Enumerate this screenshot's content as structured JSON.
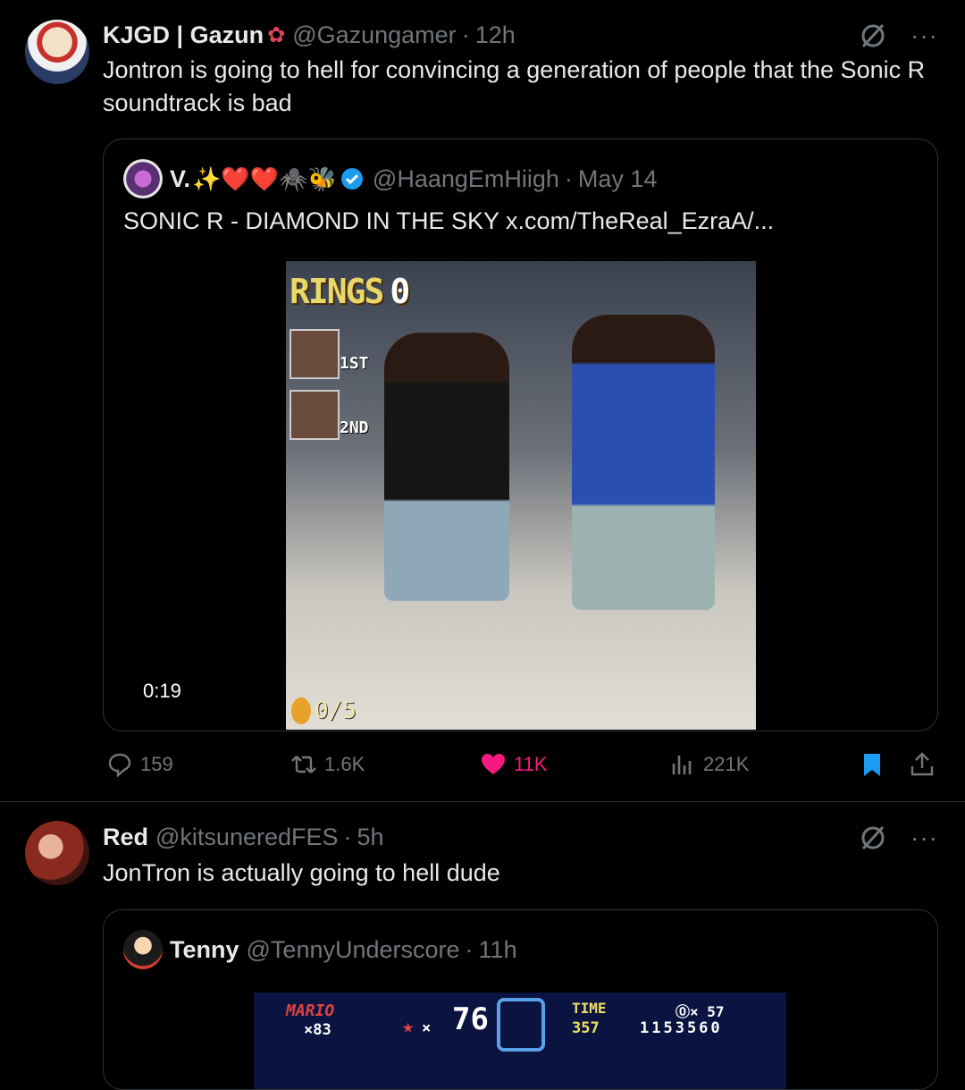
{
  "tweet1": {
    "name": "KJGD | Gazun",
    "handle": "@Gazungamer",
    "time": "12h",
    "text": "Jontron is going to hell for convincing a generation of people that the Sonic R soundtrack is bad",
    "quote": {
      "name": "V.",
      "emojis": "✨❤️❤️🕷️🐝",
      "handle": "@HaangEmHiigh",
      "time": "May 14",
      "text": "SONIC R - DIAMOND IN THE SKY  x.com/TheReal_EzraA/...",
      "video_duration": "0:19",
      "hud": {
        "rings_label": "RINGS",
        "rings_value": "0",
        "first": "1ST",
        "second": "2ND",
        "coins": "0/5"
      }
    },
    "actions": {
      "replies": "159",
      "reposts": "1.6K",
      "likes": "11K",
      "views": "221K"
    }
  },
  "tweet2": {
    "name": "Red",
    "handle": "@kitsuneredFES",
    "time": "5h",
    "text": "JonTron is actually going to hell dude",
    "quote": {
      "name": "Tenny",
      "handle": "@TennyUnderscore",
      "time": "11h",
      "hud": {
        "mario": "MARIO",
        "lives": "×83",
        "stars": "×",
        "star_count": "76",
        "time_label": "TIME",
        "time_value": "357",
        "coins": "⓪× 57",
        "score": "1153560"
      }
    }
  },
  "colors": {
    "background": "#000000",
    "text": "#e7e9ea",
    "muted": "#71767b",
    "like": "#f91880",
    "bookmark": "#1d9bf0",
    "border": "#2f3336"
  },
  "icons": [
    "grok-icon",
    "more-icon",
    "reply-icon",
    "repost-icon",
    "like-icon",
    "views-icon",
    "bookmark-icon",
    "share-icon",
    "verified-icon"
  ]
}
